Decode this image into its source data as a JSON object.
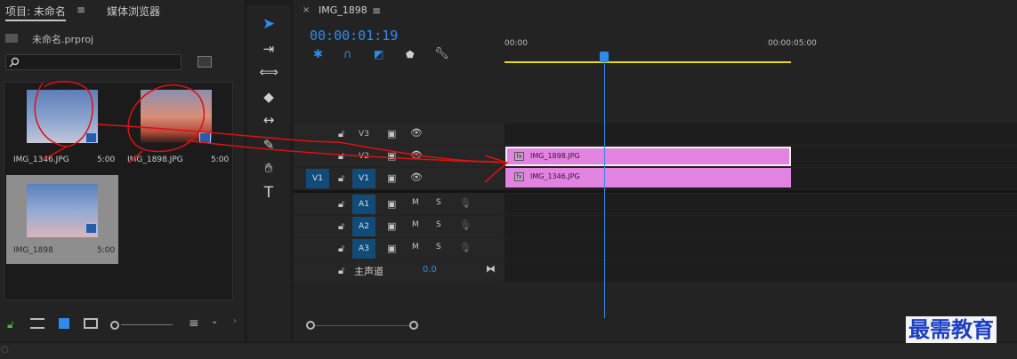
{
  "project_panel": {
    "tab_project": "项目: 未命名",
    "tab_media_browser": "媒体浏览器",
    "project_file": "未命名.prproj",
    "items": [
      {
        "name": "IMG_1346.JPG",
        "duration": "5:00"
      },
      {
        "name": "IMG_1898.JPG",
        "duration": "5:00"
      },
      {
        "name": "IMG_1898",
        "duration": "5:00"
      }
    ]
  },
  "timeline": {
    "sequence_tab": "IMG_1898",
    "timecode": "00:00:01:19",
    "ruler": [
      "00:00",
      "00:00:05:00"
    ],
    "video_tracks": [
      {
        "label": "V3"
      },
      {
        "label": "V2"
      },
      {
        "label": "V1",
        "source": "V1"
      }
    ],
    "audio_tracks": [
      {
        "label": "A1",
        "m": "M",
        "s": "S"
      },
      {
        "label": "A2",
        "m": "M",
        "s": "S"
      },
      {
        "label": "A3",
        "m": "M",
        "s": "S"
      }
    ],
    "master": {
      "label": "主声道",
      "value": "0.0"
    },
    "clips": [
      {
        "name": "IMG_1898.JPG",
        "fx": "fx"
      },
      {
        "name": "IMG_1346.JPG",
        "fx": "fx"
      }
    ]
  },
  "watermark": "最需教育",
  "colors": {
    "accent": "#2d8ceb",
    "clip": "#e283e2",
    "track_button": "#114b78"
  }
}
